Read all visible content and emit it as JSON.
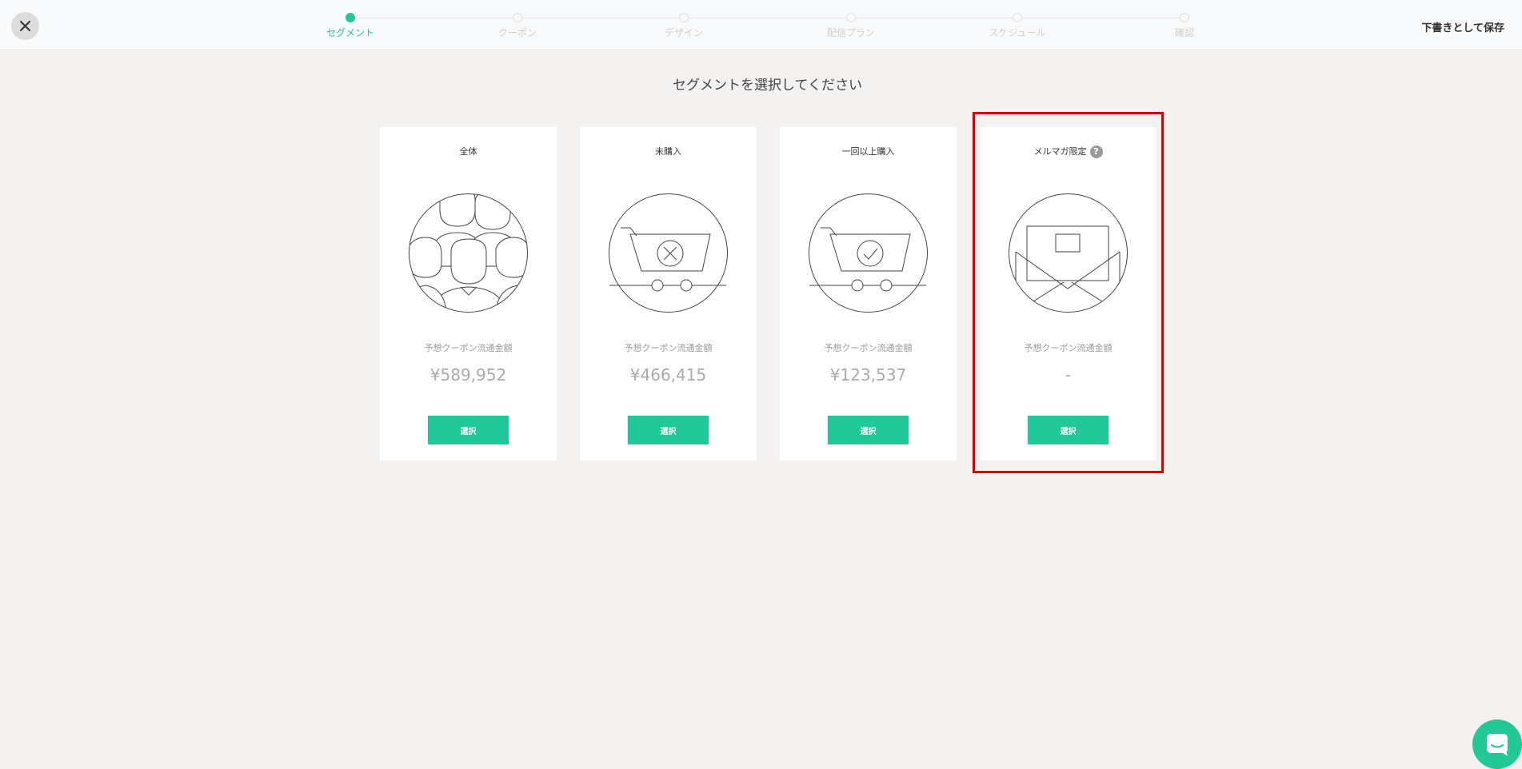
{
  "header": {
    "save_draft_label": "下書きとして保存",
    "steps": [
      {
        "label": "セグメント",
        "active": true
      },
      {
        "label": "クーポン",
        "active": false
      },
      {
        "label": "デザイン",
        "active": false
      },
      {
        "label": "配信プラン",
        "active": false
      },
      {
        "label": "スケジュール",
        "active": false
      },
      {
        "label": "確認",
        "active": false
      }
    ]
  },
  "main": {
    "title": "セグメントを選択してください",
    "cards": [
      {
        "title": "全体",
        "subtitle": "予想クーポン流通金額",
        "value": "¥589,952",
        "button_label": "選択",
        "icon": "people-group-icon"
      },
      {
        "title": "未購入",
        "subtitle": "予想クーポン流通金額",
        "value": "¥466,415",
        "button_label": "選択",
        "icon": "cart-x-icon"
      },
      {
        "title": "一回以上購入",
        "subtitle": "予想クーポン流通金額",
        "value": "¥123,537",
        "button_label": "選択",
        "icon": "cart-check-icon"
      },
      {
        "title": "メルマガ限定",
        "subtitle": "予想クーポン流通金額",
        "value": "-",
        "button_label": "選択",
        "icon": "open-envelope-icon",
        "help": "?"
      }
    ]
  },
  "colors": {
    "accent": "#20c997",
    "highlight": "#e00000",
    "background": "#f3f2f1"
  }
}
